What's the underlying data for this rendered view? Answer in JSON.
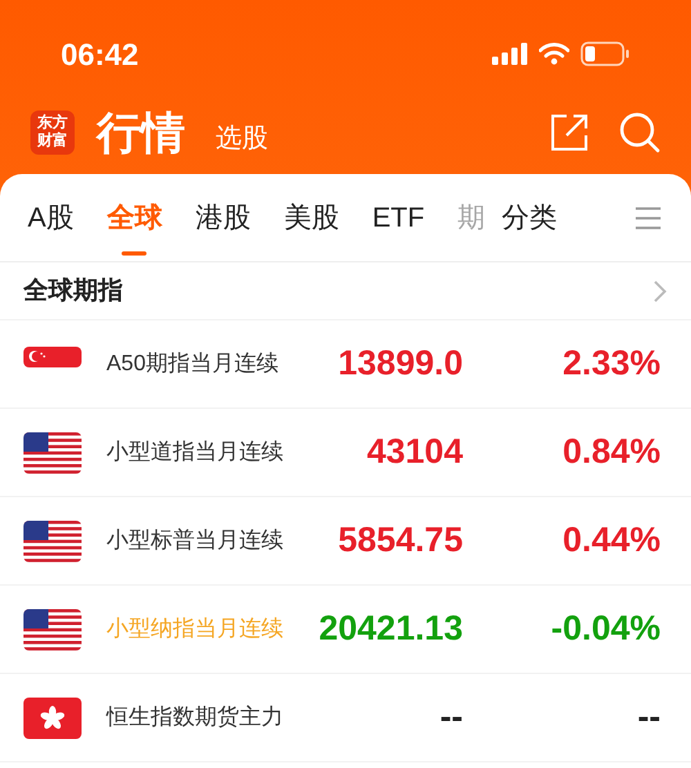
{
  "status_bar": {
    "time": "06:42"
  },
  "header": {
    "logo": "东方财富",
    "title": "行情",
    "subtitle": "选股"
  },
  "tabs": [
    {
      "label": "A股",
      "selected": false,
      "faded": false
    },
    {
      "label": "全球",
      "selected": true,
      "faded": false
    },
    {
      "label": "港股",
      "selected": false,
      "faded": false
    },
    {
      "label": "美股",
      "selected": false,
      "faded": false
    },
    {
      "label": "ETF",
      "selected": false,
      "faded": false
    },
    {
      "label": "期",
      "selected": false,
      "faded": true
    },
    {
      "label": "分类",
      "selected": false,
      "faded": false
    }
  ],
  "section": {
    "title": "全球期指"
  },
  "rows": [
    {
      "kind": "sg",
      "name": "A50期指当月连续",
      "highlighted": false,
      "color": "#e8202a",
      "price": "13899.0",
      "change": "2.33%"
    },
    {
      "kind": "us",
      "name": "小型道指当月连续",
      "highlighted": false,
      "color": "#e8202a",
      "price": "43104",
      "change": "0.84%"
    },
    {
      "kind": "us",
      "name": "小型标普当月连续",
      "highlighted": false,
      "color": "#e8202a",
      "price": "5854.75",
      "change": "0.44%"
    },
    {
      "kind": "us",
      "name": "小型纳指当月连续",
      "highlighted": true,
      "color": "#13a10e",
      "price": "20421.13",
      "change": "-0.04%"
    },
    {
      "kind": "hk",
      "name": "恒生指数期货主力",
      "highlighted": false,
      "color": "#222222",
      "price": "--",
      "change": "--"
    }
  ]
}
